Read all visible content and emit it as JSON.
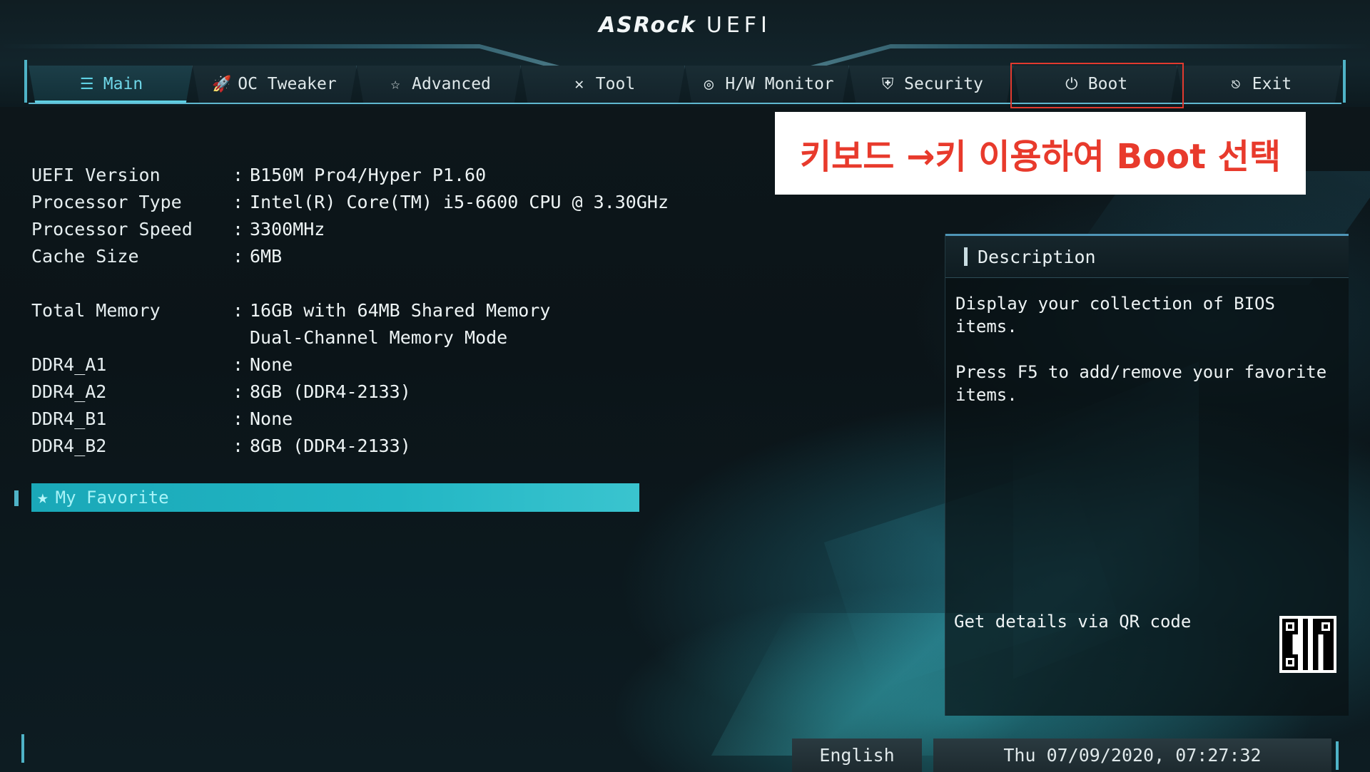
{
  "header": {
    "logo_brand": "ASRock",
    "logo_product": "UEFI"
  },
  "tabs": [
    {
      "label": "Main",
      "icon": "list-icon",
      "active": true
    },
    {
      "label": "OC Tweaker",
      "icon": "rocket-icon",
      "active": false
    },
    {
      "label": "Advanced",
      "icon": "star-icon",
      "active": false
    },
    {
      "label": "Tool",
      "icon": "tools-icon",
      "active": false
    },
    {
      "label": "H/W Monitor",
      "icon": "monitor-icon",
      "active": false
    },
    {
      "label": "Security",
      "icon": "shield-icon",
      "active": false
    },
    {
      "label": "Boot",
      "icon": "power-icon",
      "active": false
    },
    {
      "label": "Exit",
      "icon": "exit-icon",
      "active": false
    }
  ],
  "annotation": {
    "text": "키보드 →키 이용하여 Boot 선택"
  },
  "info": {
    "uefi_version": {
      "label": "UEFI Version",
      "value": "B150M Pro4/Hyper P1.60"
    },
    "processor_type": {
      "label": "Processor Type",
      "value": "Intel(R) Core(TM) i5-6600 CPU @ 3.30GHz"
    },
    "processor_speed": {
      "label": "Processor Speed",
      "value": "3300MHz"
    },
    "cache_size": {
      "label": "Cache Size",
      "value": "6MB"
    },
    "total_memory": {
      "label": "Total Memory",
      "value": "16GB with 64MB Shared Memory",
      "value2": "Dual-Channel Memory Mode"
    },
    "ddr4_a1": {
      "label": "DDR4_A1",
      "value": "None"
    },
    "ddr4_a2": {
      "label": "DDR4_A2",
      "value": "8GB (DDR4-2133)"
    },
    "ddr4_b1": {
      "label": "DDR4_B1",
      "value": "None"
    },
    "ddr4_b2": {
      "label": "DDR4_B2",
      "value": "8GB (DDR4-2133)"
    }
  },
  "favorite": {
    "label": "My Favorite"
  },
  "description": {
    "title": "Description",
    "line1": "Display your collection of BIOS items.",
    "line2": "Press F5 to add/remove your favorite items.",
    "qr_label": "Get details via QR code"
  },
  "footer": {
    "language": "English",
    "datetime": "Thu 07/09/2020, 07:27:32"
  },
  "colors": {
    "accent": "#5ed1e3",
    "annotation_red": "#e83a2c",
    "highlight_box": "#e23a2f"
  }
}
